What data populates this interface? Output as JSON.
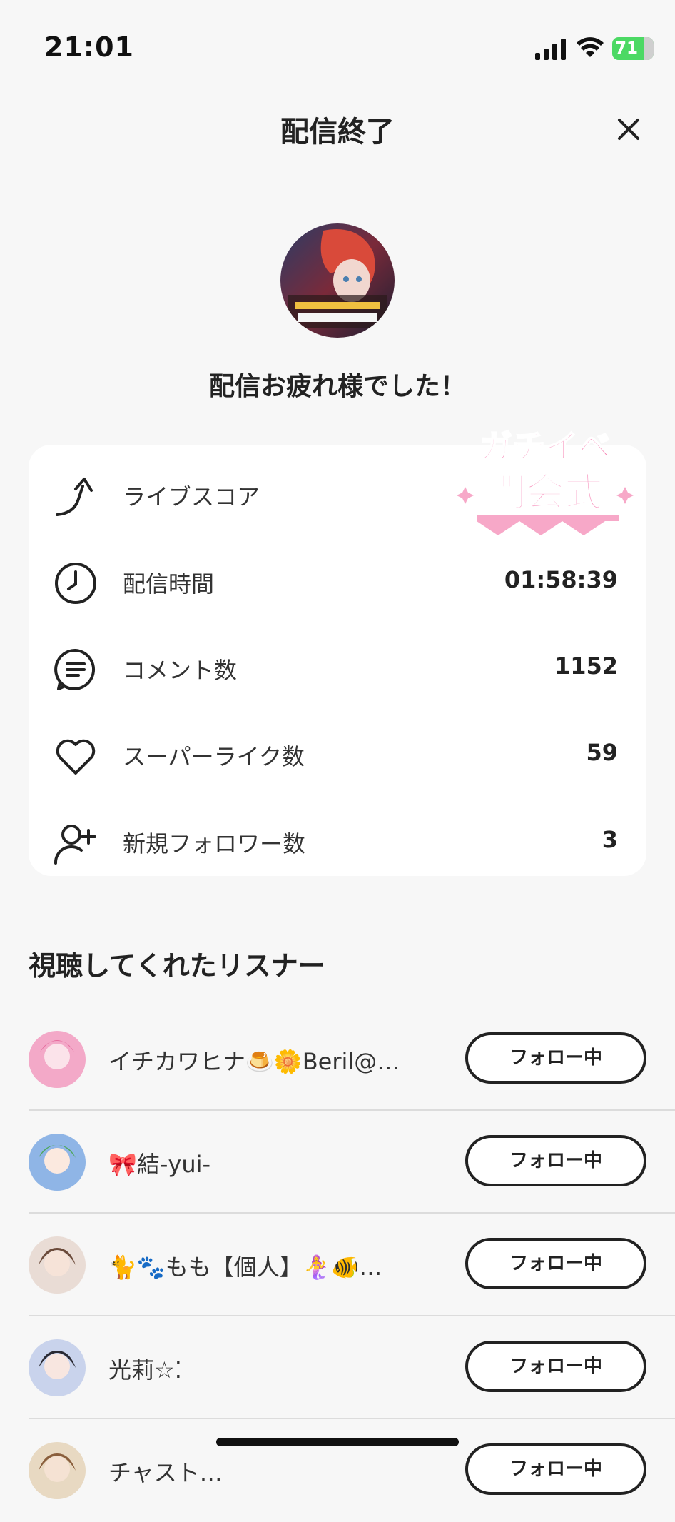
{
  "status_bar": {
    "time": "21:01",
    "battery": "71"
  },
  "header": {
    "title": "配信終了",
    "close_icon": "close-icon"
  },
  "profile": {
    "avatar_icon": "streamer-avatar"
  },
  "thanks_message": "配信お疲れ様でした！",
  "badge": {
    "line1": "ガチイベ",
    "line2": "開会式"
  },
  "stats": [
    {
      "icon": "rocket-arrow-icon",
      "label": "ライブスコア",
      "value": ""
    },
    {
      "icon": "clock-icon",
      "label": "配信時間",
      "value": "01:58:39"
    },
    {
      "icon": "comment-icon",
      "label": "コメント数",
      "value": "1152"
    },
    {
      "icon": "heart-icon",
      "label": "スーパーライク数",
      "value": "59"
    },
    {
      "icon": "person-add-icon",
      "label": "新規フォロワー数",
      "value": "3"
    }
  ],
  "listeners_section": {
    "title": "視聴してくれたリスナー",
    "items": [
      {
        "name": "イチカワヒナ🍮🌼Beril@…",
        "button": "フォロー中",
        "avatar_color": "#f3a9c8"
      },
      {
        "name": "🎀結-yui-",
        "button": "フォロー中",
        "avatar_color": "#7fcf8a"
      },
      {
        "name": "🐈🐾もも【個人】🧜‍♀️🐠…",
        "button": "フォロー中",
        "avatar_color": "#c9a89a"
      },
      {
        "name": "光莉☆⁚",
        "button": "フォロー中",
        "avatar_color": "#9aa6c9"
      },
      {
        "name": "チャスト…",
        "button": "フォロー中",
        "avatar_color": "#b8926a"
      }
    ]
  }
}
